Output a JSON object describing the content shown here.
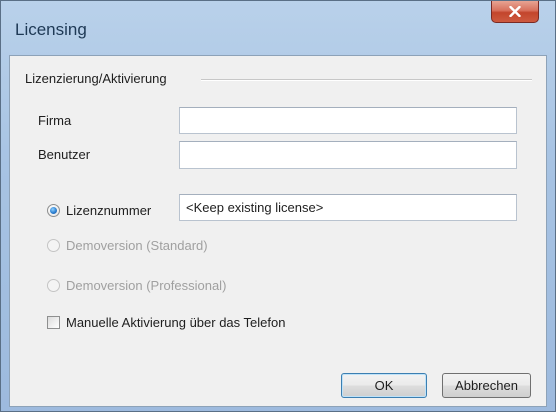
{
  "window": {
    "title": "Licensing",
    "close_icon": "close-icon"
  },
  "group": {
    "title": "Lizenzierung/Aktivierung"
  },
  "fields": {
    "company_label": "Firma",
    "company_value": "",
    "user_label": "Benutzer",
    "user_value": ""
  },
  "license_options": [
    {
      "label": "Lizenznummer",
      "checked": true,
      "enabled": true
    },
    {
      "label": "Demoversion (Standard)",
      "checked": false,
      "enabled": false
    },
    {
      "label": "Demoversion (Professional)",
      "checked": false,
      "enabled": false
    }
  ],
  "license_number": {
    "value": "<Keep existing license>"
  },
  "phone_activation": {
    "label": "Manuelle Aktivierung über das Telefon",
    "checked": false
  },
  "buttons": {
    "ok": "OK",
    "cancel": "Abbrechen"
  },
  "colors": {
    "title_text": "#1e3955",
    "close_button": "#c3452c",
    "dialog_background": "#f0f0f0",
    "disabled_text": "#a0a0a0"
  }
}
